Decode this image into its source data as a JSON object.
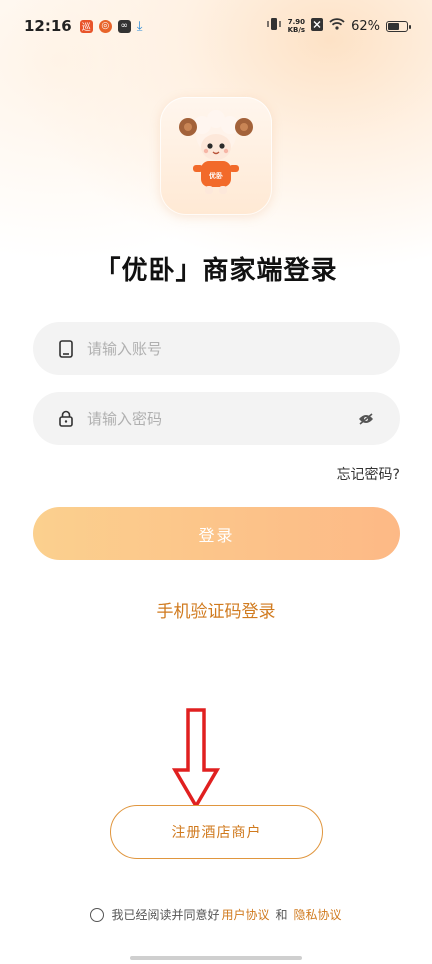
{
  "status_bar": {
    "time": "12:16",
    "net_speed_top": "7.90",
    "net_speed_bottom": "KB/s",
    "battery": "62%",
    "battery_level": 0.62
  },
  "mascot": {
    "shirt_text": "优卧"
  },
  "title": "「优卧」商家端登录",
  "account": {
    "placeholder": "请输入账号",
    "value": ""
  },
  "password": {
    "placeholder": "请输入密码",
    "value": ""
  },
  "forgot_label": "忘记密码?",
  "login_label": "登录",
  "sms_login_label": "手机验证码登录",
  "register_label": "注册酒店商户",
  "agreement": {
    "prefix": "我已经阅读并同意好",
    "user_agreement": "用户协议",
    "and": "和",
    "privacy_agreement": "隐私协议"
  },
  "colors": {
    "accent": "#d07a1e",
    "button_gradient_start": "#fbd08e",
    "button_gradient_end": "#fdb986",
    "arrow": "#e02020"
  }
}
